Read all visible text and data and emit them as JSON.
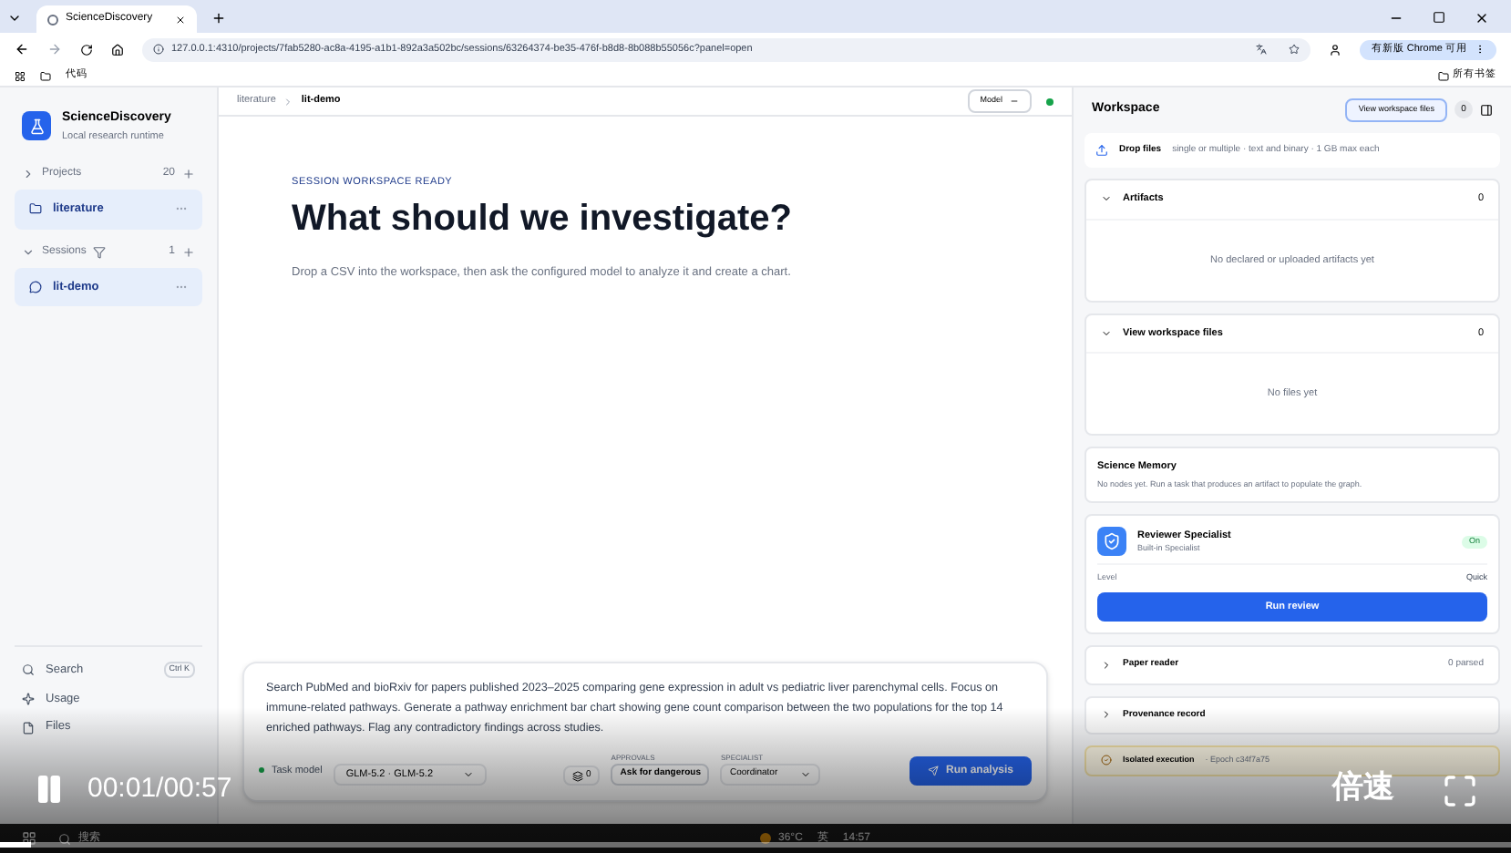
{
  "browser": {
    "tab_title": "ScienceDiscovery",
    "url": "127.0.0.1:4310/projects/7fab5280-ac8a-4195-a1b1-892a3a502bc/sessions/63264374-be35-476f-b8d8-8b088b55056c?panel=open",
    "update_button": "有新版 Chrome 可用",
    "bookmark": "代码",
    "all_bookmarks": "所有书签"
  },
  "sidebar": {
    "app_name": "ScienceDiscovery",
    "app_subtitle": "Local research runtime",
    "projects": {
      "label": "Projects",
      "count": "20",
      "expanded": false,
      "items": [
        {
          "label": "literature",
          "selected": true
        }
      ]
    },
    "sessions": {
      "label": "Sessions",
      "count": "1",
      "expanded": true,
      "items": [
        {
          "label": "lit-demo",
          "selected": true
        }
      ]
    },
    "footer": [
      {
        "kind": "search",
        "label": "Search",
        "shortcut": "Ctrl K"
      },
      {
        "kind": "usage",
        "label": "Usage"
      },
      {
        "kind": "files",
        "label": "Files"
      }
    ]
  },
  "main": {
    "breadcrumb": [
      "literature",
      "lit-demo"
    ],
    "model_chip": "Model",
    "connected": true,
    "eyebrow": "SESSION WORKSPACE READY",
    "heading": "What should we investigate?",
    "subtitle": "Drop a CSV into the workspace, then ask the configured model to analyze it and create a chart.",
    "composer": {
      "prompt": "Search PubMed and bioRxiv for papers published 2023–2025 comparing gene expression in adult vs pediatric liver parenchymal cells. Focus on immune-related pathways. Generate a pathway enrichment bar chart showing gene count comparison between the two populations for the top 14 enriched pathways. Flag any contradictory findings across studies.",
      "task_model_label": "Task model",
      "task_model": "GLM-5.2 · GLM-5.2",
      "attachments": "0",
      "approvals_label": "APPROVALS",
      "approvals": "Ask for dangerous",
      "specialist_label": "SPECIALIST",
      "specialist": "Coordinator",
      "run_button": "Run analysis"
    }
  },
  "workspace": {
    "title": "Workspace",
    "view_button": "View workspace files",
    "count": "0",
    "drop_label": "Drop files",
    "drop_hint": "single or multiple · text and binary · 1 GB max each",
    "sections": [
      {
        "title": "Artifacts",
        "count": "0",
        "expanded": true,
        "empty": "No declared or uploaded artifacts yet"
      },
      {
        "title": "View workspace files",
        "count": "0",
        "expanded": true,
        "empty": "No files yet"
      }
    ],
    "memory": {
      "title": "Science Memory",
      "text": "No nodes yet. Run a task that produces an artifact to populate the graph."
    },
    "reviewer": {
      "name": "Reviewer Specialist",
      "subtitle": "Built-in Specialist",
      "on": true,
      "status": "On",
      "level_label": "Level",
      "level_value": "Quick",
      "button": "Run review"
    },
    "collapsed": [
      {
        "title": "Paper reader",
        "meta": "0 parsed",
        "expanded": false
      },
      {
        "title": "Provenance record",
        "expanded": false
      }
    ],
    "isolation": {
      "label": "Isolated execution",
      "detail": "· Epoch c34f7a75"
    }
  },
  "video": {
    "playing": true,
    "time": "00:01/00:57",
    "speed": "倍速",
    "level": 0.02
  },
  "taskbar": {
    "search": "搜索",
    "weather": "36°C",
    "ime": "英",
    "time": "14:57"
  }
}
